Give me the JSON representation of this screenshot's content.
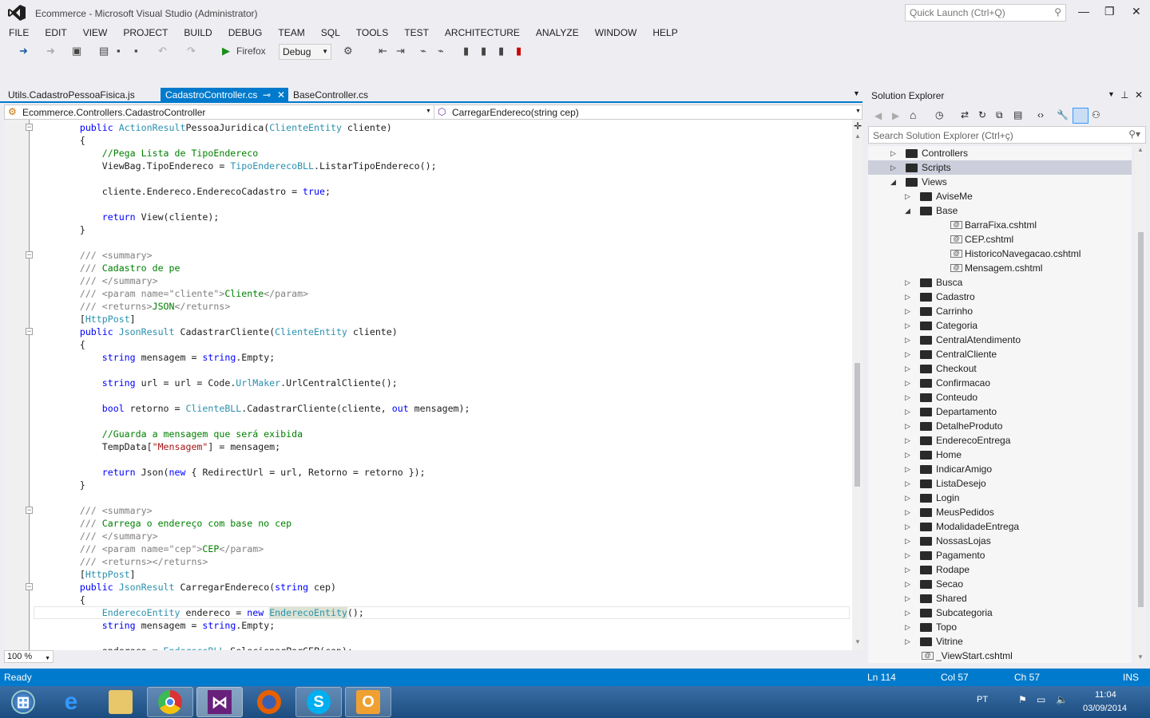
{
  "window": {
    "title": "Ecommerce - Microsoft Visual Studio (Administrator)",
    "quick_launch_placeholder": "Quick Launch (Ctrl+Q)"
  },
  "menu": [
    "FILE",
    "EDIT",
    "VIEW",
    "PROJECT",
    "BUILD",
    "DEBUG",
    "TEAM",
    "SQL",
    "TOOLS",
    "TEST",
    "ARCHITECTURE",
    "ANALYZE",
    "WINDOW",
    "HELP"
  ],
  "toolbar": {
    "run_target": "Firefox",
    "configuration": "Debug"
  },
  "tabs": [
    {
      "label": "Utils.CadastroPessoaFisica.js",
      "active": false
    },
    {
      "label": "CadastroController.cs",
      "active": true
    },
    {
      "label": "BaseController.cs",
      "active": false
    }
  ],
  "navbar": {
    "class": "Ecommerce.Controllers.CadastroController",
    "member": "CarregarEndereco(string cep)"
  },
  "code": [
    [
      8,
      [
        [
          "k",
          "public "
        ],
        [
          "t",
          "ActionResult"
        ],
        [
          "",
          "PessoaJuridica("
        ],
        [
          "t",
          "ClienteEntity"
        ],
        [
          "",
          " cliente)"
        ]
      ]
    ],
    [
      8,
      [
        [
          "",
          "{"
        ]
      ]
    ],
    [
      12,
      [
        [
          "c",
          "//Pega Lista de TipoEndereco"
        ]
      ]
    ],
    [
      12,
      [
        [
          "",
          "ViewBag.TipoEndereco = "
        ],
        [
          "t",
          "TipoEnderecoBLL"
        ],
        [
          "",
          ".ListarTipoEndereco();"
        ]
      ]
    ],
    [
      0,
      []
    ],
    [
      12,
      [
        [
          "",
          "cliente.Endereco.EnderecoCadastro = "
        ],
        [
          "k",
          "true"
        ],
        [
          "",
          ";"
        ]
      ]
    ],
    [
      0,
      []
    ],
    [
      12,
      [
        [
          "k",
          "return "
        ],
        [
          "",
          "View(cliente);"
        ]
      ]
    ],
    [
      8,
      [
        [
          "",
          "}"
        ]
      ]
    ],
    [
      0,
      []
    ],
    [
      8,
      [
        [
          "x",
          "/// <summary>"
        ]
      ]
    ],
    [
      8,
      [
        [
          "x",
          "/// "
        ],
        [
          "c",
          "Cadastro de pe"
        ]
      ]
    ],
    [
      8,
      [
        [
          "x",
          "/// </summary>"
        ]
      ]
    ],
    [
      8,
      [
        [
          "x",
          "/// <param name=\"cliente\">"
        ],
        [
          "c",
          "Cliente"
        ],
        [
          "x",
          "</param>"
        ]
      ]
    ],
    [
      8,
      [
        [
          "x",
          "/// <returns>"
        ],
        [
          "c",
          "JSON"
        ],
        [
          "x",
          "</returns>"
        ]
      ]
    ],
    [
      8,
      [
        [
          "",
          "["
        ],
        [
          "t",
          "HttpPost"
        ],
        [
          "",
          "]"
        ]
      ]
    ],
    [
      8,
      [
        [
          "k",
          "public "
        ],
        [
          "t",
          "JsonResult"
        ],
        [
          "",
          " CadastrarCliente("
        ],
        [
          "t",
          "ClienteEntity"
        ],
        [
          "",
          " cliente)"
        ]
      ]
    ],
    [
      8,
      [
        [
          "",
          "{"
        ]
      ]
    ],
    [
      12,
      [
        [
          "k",
          "string"
        ],
        [
          "",
          " mensagem = "
        ],
        [
          "k",
          "string"
        ],
        [
          "",
          ".Empty;"
        ]
      ]
    ],
    [
      0,
      []
    ],
    [
      12,
      [
        [
          "k",
          "string"
        ],
        [
          "",
          " url = url = Code."
        ],
        [
          "t",
          "UrlMaker"
        ],
        [
          "",
          ".UrlCentralCliente();"
        ]
      ]
    ],
    [
      0,
      []
    ],
    [
      12,
      [
        [
          "k",
          "bool"
        ],
        [
          "",
          " retorno = "
        ],
        [
          "t",
          "ClienteBLL"
        ],
        [
          "",
          ".CadastrarCliente(cliente, "
        ],
        [
          "k",
          "out"
        ],
        [
          "",
          " mensagem);"
        ]
      ]
    ],
    [
      0,
      []
    ],
    [
      12,
      [
        [
          "c",
          "//Guarda a mensagem que será exibida"
        ]
      ]
    ],
    [
      12,
      [
        [
          "",
          "TempData["
        ],
        [
          "s",
          "\"Mensagem\""
        ],
        [
          "",
          "] = mensagem;"
        ]
      ]
    ],
    [
      0,
      []
    ],
    [
      12,
      [
        [
          "k",
          "return "
        ],
        [
          "",
          "Json("
        ],
        [
          "k",
          "new"
        ],
        [
          "",
          " { RedirectUrl = url, Retorno = retorno });"
        ]
      ]
    ],
    [
      8,
      [
        [
          "",
          "}"
        ]
      ]
    ],
    [
      0,
      []
    ],
    [
      8,
      [
        [
          "x",
          "/// <summary>"
        ]
      ]
    ],
    [
      8,
      [
        [
          "x",
          "/// "
        ],
        [
          "c",
          "Carrega o endereço com base no cep"
        ]
      ]
    ],
    [
      8,
      [
        [
          "x",
          "/// </summary>"
        ]
      ]
    ],
    [
      8,
      [
        [
          "x",
          "/// <param name=\"cep\">"
        ],
        [
          "c",
          "CEP"
        ],
        [
          "x",
          "</param>"
        ]
      ]
    ],
    [
      8,
      [
        [
          "x",
          "/// <returns></returns>"
        ]
      ]
    ],
    [
      8,
      [
        [
          "",
          "["
        ],
        [
          "t",
          "HttpPost"
        ],
        [
          "",
          "]"
        ]
      ]
    ],
    [
      8,
      [
        [
          "k",
          "public "
        ],
        [
          "t",
          "JsonResult"
        ],
        [
          "",
          " CarregarEndereco("
        ],
        [
          "k",
          "string"
        ],
        [
          "",
          " cep)"
        ]
      ]
    ],
    [
      8,
      [
        [
          "",
          "{"
        ]
      ]
    ],
    [
      12,
      [
        [
          "t",
          "EnderecoEntity"
        ],
        [
          "",
          " endereco = "
        ],
        [
          "k",
          "new "
        ],
        [
          "t",
          "EnderecoEntity"
        ],
        [
          "",
          "();"
        ]
      ]
    ],
    [
      12,
      [
        [
          "k",
          "string"
        ],
        [
          "",
          " mensagem = "
        ],
        [
          "k",
          "string"
        ],
        [
          "",
          ".Empty;"
        ]
      ]
    ],
    [
      0,
      []
    ],
    [
      12,
      [
        [
          "",
          "endereco = "
        ],
        [
          "t",
          "EnderecoBLL"
        ],
        [
          "",
          ".SelecionarPorCEP(cep);"
        ]
      ]
    ]
  ],
  "editor": {
    "zoom": "100 %",
    "current_line_index": 38
  },
  "solution_explorer": {
    "title": "Solution Explorer",
    "search_placeholder": "Search Solution Explorer (Ctrl+ç)",
    "nodes": [
      {
        "label": "Controllers",
        "level": 0,
        "type": "folder",
        "state": "collapsed"
      },
      {
        "label": "Scripts",
        "level": 0,
        "type": "folder",
        "state": "collapsed",
        "selected": true
      },
      {
        "label": "Views",
        "level": 0,
        "type": "folder",
        "state": "expanded"
      },
      {
        "label": "AviseMe",
        "level": 1,
        "type": "folder",
        "state": "collapsed"
      },
      {
        "label": "Base",
        "level": 1,
        "type": "folder",
        "state": "expanded"
      },
      {
        "label": "BarraFixa.cshtml",
        "level": 2,
        "type": "file"
      },
      {
        "label": "CEP.cshtml",
        "level": 2,
        "type": "file"
      },
      {
        "label": "HistoricoNavegacao.cshtml",
        "level": 2,
        "type": "file"
      },
      {
        "label": "Mensagem.cshtml",
        "level": 2,
        "type": "file"
      },
      {
        "label": "Busca",
        "level": 1,
        "type": "folder",
        "state": "collapsed"
      },
      {
        "label": "Cadastro",
        "level": 1,
        "type": "folder",
        "state": "collapsed"
      },
      {
        "label": "Carrinho",
        "level": 1,
        "type": "folder",
        "state": "collapsed"
      },
      {
        "label": "Categoria",
        "level": 1,
        "type": "folder",
        "state": "collapsed"
      },
      {
        "label": "CentralAtendimento",
        "level": 1,
        "type": "folder",
        "state": "collapsed"
      },
      {
        "label": "CentralCliente",
        "level": 1,
        "type": "folder",
        "state": "collapsed"
      },
      {
        "label": "Checkout",
        "level": 1,
        "type": "folder",
        "state": "collapsed"
      },
      {
        "label": "Confirmacao",
        "level": 1,
        "type": "folder",
        "state": "collapsed"
      },
      {
        "label": "Conteudo",
        "level": 1,
        "type": "folder",
        "state": "collapsed"
      },
      {
        "label": "Departamento",
        "level": 1,
        "type": "folder",
        "state": "collapsed"
      },
      {
        "label": "DetalheProduto",
        "level": 1,
        "type": "folder",
        "state": "collapsed"
      },
      {
        "label": "EnderecoEntrega",
        "level": 1,
        "type": "folder",
        "state": "collapsed"
      },
      {
        "label": "Home",
        "level": 1,
        "type": "folder",
        "state": "collapsed"
      },
      {
        "label": "IndicarAmigo",
        "level": 1,
        "type": "folder",
        "state": "collapsed"
      },
      {
        "label": "ListaDesejo",
        "level": 1,
        "type": "folder",
        "state": "collapsed"
      },
      {
        "label": "Login",
        "level": 1,
        "type": "folder",
        "state": "collapsed"
      },
      {
        "label": "MeusPedidos",
        "level": 1,
        "type": "folder",
        "state": "collapsed"
      },
      {
        "label": "ModalidadeEntrega",
        "level": 1,
        "type": "folder",
        "state": "collapsed"
      },
      {
        "label": "NossasLojas",
        "level": 1,
        "type": "folder",
        "state": "collapsed"
      },
      {
        "label": "Pagamento",
        "level": 1,
        "type": "folder",
        "state": "collapsed"
      },
      {
        "label": "Rodape",
        "level": 1,
        "type": "folder",
        "state": "collapsed"
      },
      {
        "label": "Secao",
        "level": 1,
        "type": "folder",
        "state": "collapsed"
      },
      {
        "label": "Shared",
        "level": 1,
        "type": "folder",
        "state": "collapsed"
      },
      {
        "label": "Subcategoria",
        "level": 1,
        "type": "folder",
        "state": "collapsed"
      },
      {
        "label": "Topo",
        "level": 1,
        "type": "folder",
        "state": "collapsed"
      },
      {
        "label": "Vitrine",
        "level": 1,
        "type": "folder",
        "state": "collapsed"
      },
      {
        "label": "_ViewStart.cshtml",
        "level": 1,
        "type": "file"
      }
    ]
  },
  "status": {
    "text": "Ready",
    "line": "Ln 114",
    "col": "Col 57",
    "ch": "Ch 57",
    "mode": "INS"
  },
  "taskbar": {
    "apps": [
      "windows-start",
      "internet-explorer",
      "file-explorer",
      "chrome",
      "visual-studio",
      "firefox",
      "skype",
      "outlook"
    ],
    "language": "PT",
    "time": "11:04",
    "date": "03/09/2014"
  },
  "colors": {
    "accent": "#007acc",
    "keyword": "#0000ff",
    "type": "#2b91af",
    "comment": "#008000",
    "string": "#a31515"
  }
}
